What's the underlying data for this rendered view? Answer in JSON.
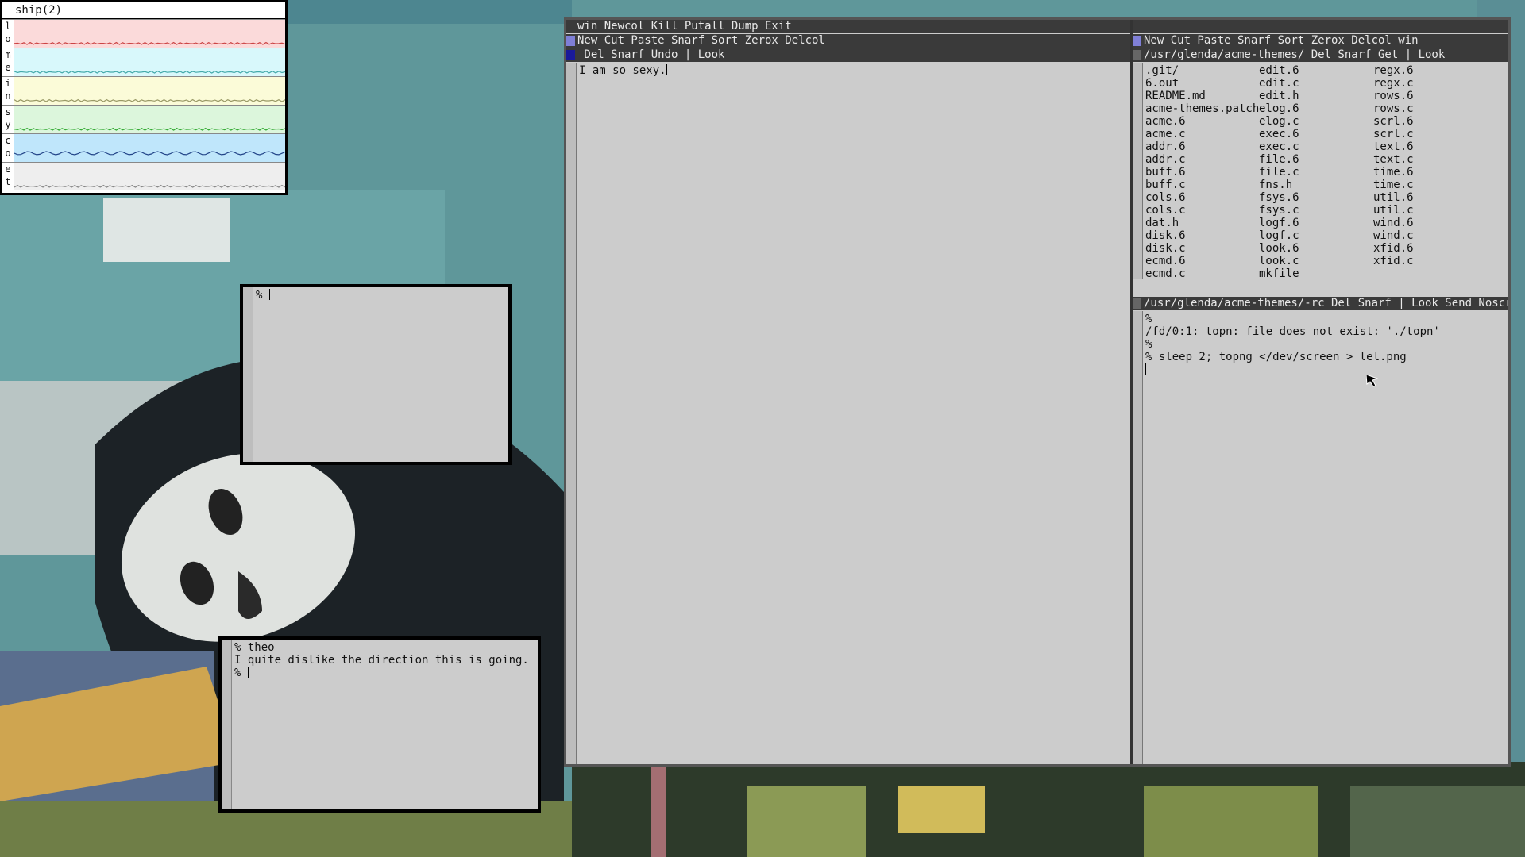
{
  "stats": {
    "title": "ship(2)",
    "rows": [
      {
        "label": "lo",
        "color": "#fbdada",
        "line": "#c44"
      },
      {
        "label": "me",
        "color": "#d8f8fb",
        "line": "#4aa"
      },
      {
        "label": "in",
        "color": "#fbfbd8",
        "line": "#996"
      },
      {
        "label": "sy",
        "color": "#dcf6dc",
        "line": "#3a3"
      },
      {
        "label": "co",
        "color": "#bfe6fb",
        "line": "#248"
      },
      {
        "label": "et",
        "color": "#eeeeee",
        "line": "#888"
      }
    ]
  },
  "rio_small": {
    "text": "% "
  },
  "rio_chat": {
    "lines": [
      "% theo",
      "I quite dislike the direction this is going.",
      "% "
    ]
  },
  "acme": {
    "main_tag": "win Newcol Kill Putall Dump Exit",
    "left_col_tag": "New Cut Paste Snarf Sort Zerox Delcol ",
    "left_win_tag": " Del Snarf Undo | Look ",
    "left_win_body": "I am so sexy.",
    "right_col_tag": "New Cut Paste Snarf Sort Zerox Delcol win",
    "dir_tag": "/usr/glenda/acme-themes/ Del Snarf Get | Look ",
    "files": [
      [
        ".git/",
        "6.out",
        "README.md",
        "acme-themes.patch",
        "acme.6",
        "acme.c",
        "addr.6",
        "addr.c",
        "buff.6",
        "buff.c",
        "cols.6",
        "cols.c",
        "dat.h",
        "disk.6",
        "disk.c",
        "ecmd.6",
        "ecmd.c"
      ],
      [
        "edit.6",
        "edit.c",
        "edit.h",
        "elog.6",
        "elog.c",
        "exec.6",
        "exec.c",
        "file.6",
        "file.c",
        "fns.h",
        "fsys.6",
        "fsys.c",
        "logf.6",
        "logf.c",
        "look.6",
        "look.c",
        "mkfile"
      ],
      [
        "regx.6",
        "regx.c",
        "rows.6",
        "rows.c",
        "scrl.6",
        "scrl.c",
        "text.6",
        "text.c",
        "time.6",
        "time.c",
        "util.6",
        "util.c",
        "wind.6",
        "wind.c",
        "xfid.6",
        "xfid.c"
      ]
    ],
    "rc_tag": "/usr/glenda/acme-themes/-rc Del Snarf | Look Send Noscroll",
    "rc_lines": [
      "%",
      "/fd/0:1: topn: file does not exist: './topn'",
      "%",
      "% sleep 2; topng </dev/screen > lel.png",
      ""
    ]
  }
}
